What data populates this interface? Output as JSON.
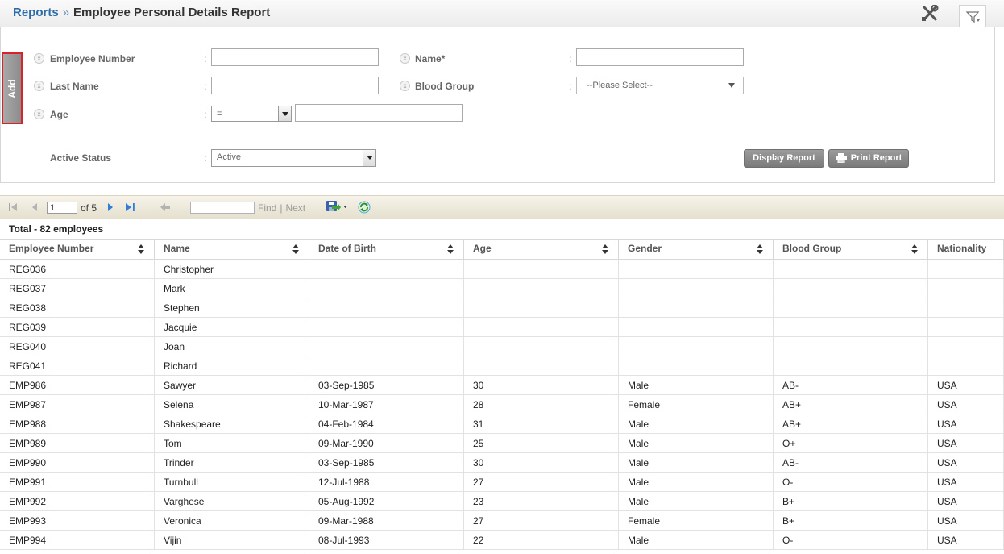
{
  "breadcrumb": {
    "parent": "Reports",
    "separator": "»",
    "title": "Employee Personal Details Report"
  },
  "filters": {
    "add_label": "Add",
    "employee_number": {
      "label": "Employee Number",
      "value": ""
    },
    "name": {
      "label": "Name*",
      "value": ""
    },
    "last_name": {
      "label": "Last Name",
      "value": ""
    },
    "blood_group": {
      "label": "Blood Group",
      "value": "--Please Select--"
    },
    "age": {
      "label": "Age",
      "operator": "=",
      "value": ""
    },
    "active_status": {
      "label": "Active Status",
      "value": "Active"
    },
    "colon": ":",
    "x": "x"
  },
  "buttons": {
    "display_report": "Display Report",
    "print_report": "Print Report"
  },
  "toolbar": {
    "page": "1",
    "of_pages": "of 5",
    "find": "Find",
    "sep": "|",
    "next": "Next"
  },
  "table": {
    "total": "Total - 82 employees",
    "columns": [
      "Employee Number",
      "Name",
      "Date of Birth",
      "Age",
      "Gender",
      "Blood Group",
      "Nationality"
    ],
    "rows": [
      [
        "REG036",
        "Christopher",
        "",
        "",
        "",
        "",
        ""
      ],
      [
        "REG037",
        "Mark",
        "",
        "",
        "",
        "",
        ""
      ],
      [
        "REG038",
        "Stephen",
        "",
        "",
        "",
        "",
        ""
      ],
      [
        "REG039",
        "Jacquie",
        "",
        "",
        "",
        "",
        ""
      ],
      [
        "REG040",
        "Joan",
        "",
        "",
        "",
        "",
        ""
      ],
      [
        "REG041",
        "Richard",
        "",
        "",
        "",
        "",
        ""
      ],
      [
        "EMP986",
        "Sawyer",
        "03-Sep-1985",
        "30",
        "Male",
        "AB-",
        "USA"
      ],
      [
        "EMP987",
        "Selena",
        "10-Mar-1987",
        "28",
        "Female",
        "AB+",
        "USA"
      ],
      [
        "EMP988",
        "Shakespeare",
        "04-Feb-1984",
        "31",
        "Male",
        "AB+",
        "USA"
      ],
      [
        "EMP989",
        "Tom",
        "09-Mar-1990",
        "25",
        "Male",
        "O+",
        "USA"
      ],
      [
        "EMP990",
        "Trinder",
        "03-Sep-1985",
        "30",
        "Male",
        "AB-",
        "USA"
      ],
      [
        "EMP991",
        "Turnbull",
        "12-Jul-1988",
        "27",
        "Male",
        "O-",
        "USA"
      ],
      [
        "EMP992",
        "Varghese",
        "05-Aug-1992",
        "23",
        "Male",
        "B+",
        "USA"
      ],
      [
        "EMP993",
        "Veronica",
        "09-Mar-1988",
        "27",
        "Female",
        "B+",
        "USA"
      ],
      [
        "EMP994",
        "Vijin",
        "08-Jul-1993",
        "22",
        "Male",
        "O-",
        "USA"
      ]
    ]
  },
  "icons": [
    "tools-icon",
    "filter-icon",
    "first-page-icon",
    "prev-page-icon",
    "next-page-icon",
    "last-page-icon",
    "back-icon",
    "export-icon",
    "refresh-icon",
    "sort-icon",
    "printer-icon"
  ]
}
